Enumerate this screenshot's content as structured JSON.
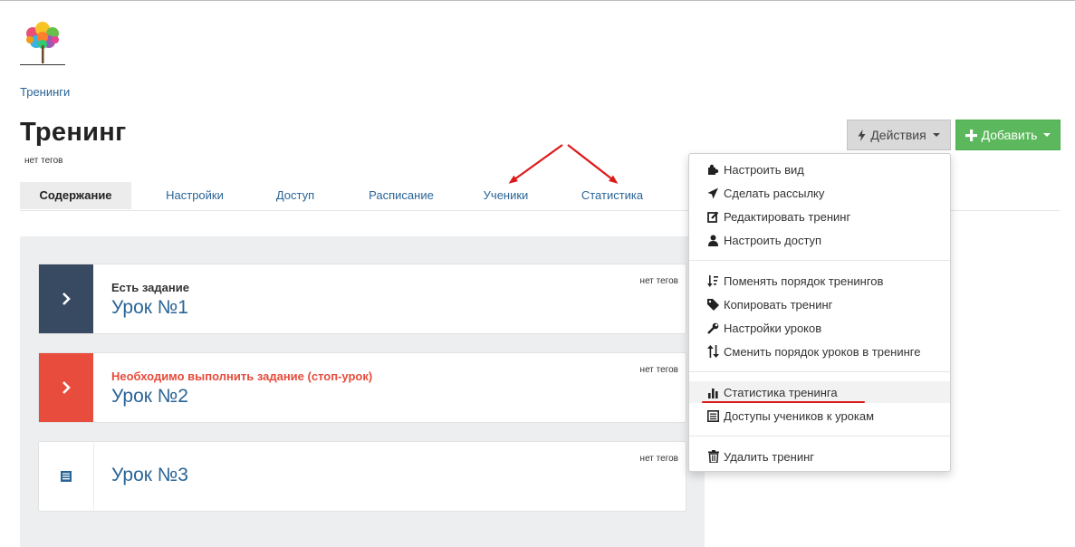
{
  "header": {
    "breadcrumb": "Тренинги",
    "page_title": "Тренинг",
    "tags_label": "нет тегов",
    "actions_label": "Действия",
    "add_label": "Добавить"
  },
  "tabs": [
    {
      "label": "Содержание",
      "active": true
    },
    {
      "label": "Настройки"
    },
    {
      "label": "Доступ"
    },
    {
      "label": "Расписание"
    },
    {
      "label": "Ученики"
    },
    {
      "label": "Статистика"
    }
  ],
  "lessons": [
    {
      "status": "Есть задание",
      "title": "Урок №1",
      "tags": "нет тегов",
      "accent": "#374a61",
      "icon": "chevron-right-icon"
    },
    {
      "status": "Необходимо выполнить задание (стоп-урок)",
      "title": "Урок №2",
      "tags": "нет тегов",
      "accent": "#e74c3c",
      "icon": "chevron-right-icon"
    },
    {
      "status": "",
      "title": "Урок №3",
      "tags": "нет тегов",
      "accent": "#ffffff",
      "icon": "list-icon"
    }
  ],
  "actions_menu": {
    "groups": [
      [
        {
          "label": "Настроить вид",
          "icon": "puzzle-icon"
        },
        {
          "label": "Сделать рассылку",
          "icon": "send-icon"
        },
        {
          "label": "Редактировать тренинг",
          "icon": "edit-icon"
        },
        {
          "label": "Настроить доступ",
          "icon": "user-icon"
        }
      ],
      [
        {
          "label": "Поменять порядок тренингов",
          "icon": "sort-icon"
        },
        {
          "label": "Копировать тренинг",
          "icon": "tags-icon"
        },
        {
          "label": "Настройки уроков",
          "icon": "wrench-icon"
        },
        {
          "label": "Сменить порядок уроков в тренинге",
          "icon": "sort-arrows-icon"
        }
      ],
      [
        {
          "label": "Статистика тренинга",
          "icon": "bar-chart-icon",
          "highlighted": true
        },
        {
          "label": "Доступы учеников к урокам",
          "icon": "list-alt-icon"
        }
      ],
      [
        {
          "label": "Удалить тренинг",
          "icon": "trash-icon"
        }
      ]
    ]
  },
  "colors": {
    "accent_blue": "#2a6496",
    "success_green": "#5cb85c",
    "danger_red": "#e74c3c",
    "dark_slate": "#374a61",
    "annotation_red": "#dd1a1a"
  }
}
